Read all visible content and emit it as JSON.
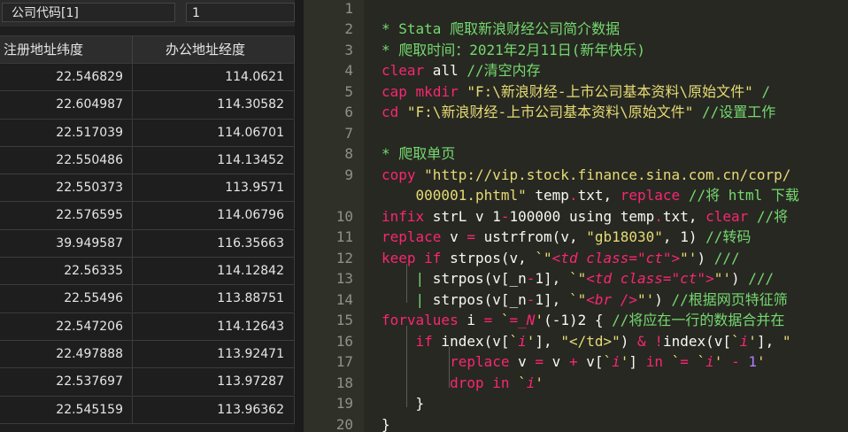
{
  "data_browser": {
    "var_name": "公司代码[1]",
    "var_value": "1",
    "columns": [
      "注册地址纬度",
      "办公地址经度"
    ],
    "rows": [
      [
        "22.546829",
        "114.0621"
      ],
      [
        "22.604987",
        "114.30582"
      ],
      [
        "22.517039",
        "114.06701"
      ],
      [
        "22.550486",
        "114.13452"
      ],
      [
        "22.550373",
        "113.9571"
      ],
      [
        "22.576595",
        "114.06796"
      ],
      [
        "39.949587",
        "116.35663"
      ],
      [
        "22.56335",
        "114.12842"
      ],
      [
        "22.55496",
        "113.88751"
      ],
      [
        "22.547206",
        "114.12643"
      ],
      [
        "22.497888",
        "113.92471"
      ],
      [
        "22.537697",
        "113.97287"
      ],
      [
        "22.545159",
        "113.96362"
      ]
    ]
  },
  "editor": {
    "lines": [
      {
        "n": "1",
        "segs": []
      },
      {
        "n": "2",
        "segs": [
          [
            "cm",
            "* Stata 爬取新浪财经公司简介数据"
          ]
        ]
      },
      {
        "n": "3",
        "segs": [
          [
            "cm",
            "* 爬取时间：2021年2月11日(新年快乐)"
          ]
        ]
      },
      {
        "n": "4",
        "segs": [
          [
            "kw",
            "clear"
          ],
          [
            "",
            " all "
          ],
          [
            "cm",
            "//清空内存"
          ]
        ]
      },
      {
        "n": "5",
        "segs": [
          [
            "kw",
            "cap"
          ],
          [
            "",
            " "
          ],
          [
            "kw",
            "mkdir"
          ],
          [
            "",
            " "
          ],
          [
            "st",
            "\"F:\\新浪财经-上市公司基本资料\\原始文件\""
          ],
          [
            "",
            " "
          ],
          [
            "cm",
            "/"
          ]
        ]
      },
      {
        "n": "6",
        "segs": [
          [
            "kw",
            "cd"
          ],
          [
            "",
            " "
          ],
          [
            "st",
            "\"F:\\新浪财经-上市公司基本资料\\原始文件\""
          ],
          [
            "",
            " "
          ],
          [
            "cm",
            "//设置工作"
          ]
        ]
      },
      {
        "n": "7",
        "segs": []
      },
      {
        "n": "8",
        "segs": [
          [
            "cm",
            "* 爬取单页"
          ]
        ]
      },
      {
        "n": "9",
        "segs": [
          [
            "kw",
            "copy"
          ],
          [
            "",
            " "
          ],
          [
            "st",
            "\"http://vip.stock.finance.sina.com.cn/corp/"
          ]
        ]
      },
      {
        "n": "",
        "segs": [
          [
            "st",
            "    000001.phtml\""
          ],
          [
            "",
            " temp"
          ],
          [
            "kw",
            "."
          ],
          [
            "",
            "txt, "
          ],
          [
            "kw",
            "replace"
          ],
          [
            "",
            " "
          ],
          [
            "cm",
            "//将 html 下载"
          ]
        ]
      },
      {
        "n": "10",
        "segs": [
          [
            "kw",
            "infix"
          ],
          [
            "",
            " strL v 1"
          ],
          [
            "kw",
            "-"
          ],
          [
            "",
            "100000 using temp"
          ],
          [
            "kw",
            "."
          ],
          [
            "",
            "txt, "
          ],
          [
            "kw",
            "clear"
          ],
          [
            "",
            " "
          ],
          [
            "cm",
            "//将"
          ]
        ]
      },
      {
        "n": "11",
        "segs": [
          [
            "kw",
            "replace"
          ],
          [
            "",
            " v "
          ],
          [
            "kw",
            "="
          ],
          [
            "",
            " ustrfrom(v, "
          ],
          [
            "st",
            "\"gb18030\""
          ],
          [
            "",
            ", 1) "
          ],
          [
            "cm",
            "//转码"
          ]
        ]
      },
      {
        "n": "12",
        "segs": [
          [
            "kw",
            "keep"
          ],
          [
            "",
            " "
          ],
          [
            "kw",
            "if"
          ],
          [
            "",
            " strpos(v, "
          ],
          [
            "st",
            "`\""
          ],
          [
            "it",
            "<td class=\"ct\">"
          ],
          [
            "st",
            "\"'"
          ],
          [
            "",
            ") "
          ],
          [
            "cm",
            "///"
          ]
        ]
      },
      {
        "n": "13",
        "segs": [
          [
            "",
            "    "
          ],
          [
            "cm",
            "|"
          ],
          [
            "",
            " strpos(v[_n"
          ],
          [
            "kw",
            "-"
          ],
          [
            "",
            "1], "
          ],
          [
            "st",
            "`\""
          ],
          [
            "it",
            "<td class=\"ct\">"
          ],
          [
            "st",
            "\"'"
          ],
          [
            "",
            ") "
          ],
          [
            "cm",
            "///"
          ]
        ]
      },
      {
        "n": "14",
        "segs": [
          [
            "",
            "    "
          ],
          [
            "cm",
            "|"
          ],
          [
            "",
            " strpos(v[_n"
          ],
          [
            "kw",
            "-"
          ],
          [
            "",
            "1], "
          ],
          [
            "st",
            "`\""
          ],
          [
            "it",
            "<br />"
          ],
          [
            "st",
            "\"'"
          ],
          [
            "",
            ") "
          ],
          [
            "cm",
            "//根据网页特征筛"
          ]
        ]
      },
      {
        "n": "15",
        "segs": [
          [
            "kw",
            "forvalues"
          ],
          [
            "",
            " i "
          ],
          [
            "kw",
            "="
          ],
          [
            "",
            " "
          ],
          [
            "st",
            "`"
          ],
          [
            "kw",
            "="
          ],
          [
            "it",
            "_N"
          ],
          [
            "st",
            "'"
          ],
          [
            "",
            "(-1)2 { "
          ],
          [
            "cm",
            "//将应在一行的数据合并在"
          ]
        ]
      },
      {
        "n": "16",
        "segs": [
          [
            "",
            "    "
          ],
          [
            "kw",
            "if"
          ],
          [
            "",
            " index(v["
          ],
          [
            "st",
            "`"
          ],
          [
            "it",
            "i"
          ],
          [
            "st",
            "'"
          ],
          [
            "",
            "], "
          ],
          [
            "st",
            "\"</td>\""
          ],
          [
            "",
            ") "
          ],
          [
            "kw",
            "&"
          ],
          [
            "",
            " "
          ],
          [
            "kw",
            "!"
          ],
          [
            "",
            "index(v["
          ],
          [
            "st",
            "`"
          ],
          [
            "it",
            "i"
          ],
          [
            "st",
            "'"
          ],
          [
            "",
            "], "
          ],
          [
            "st",
            "\""
          ]
        ]
      },
      {
        "n": "17",
        "segs": [
          [
            "",
            "        "
          ],
          [
            "kw",
            "replace"
          ],
          [
            "",
            " v "
          ],
          [
            "kw",
            "="
          ],
          [
            "",
            " v "
          ],
          [
            "kw",
            "+"
          ],
          [
            "",
            " v["
          ],
          [
            "st",
            "`"
          ],
          [
            "it",
            "i"
          ],
          [
            "st",
            "'"
          ],
          [
            "",
            "] "
          ],
          [
            "kw",
            "in"
          ],
          [
            "",
            " "
          ],
          [
            "st",
            "`"
          ],
          [
            "kw",
            "="
          ],
          [
            "",
            " "
          ],
          [
            "st",
            "`"
          ],
          [
            "it",
            "i"
          ],
          [
            "st",
            "'"
          ],
          [
            "",
            " "
          ],
          [
            "kw",
            "-"
          ],
          [
            "",
            " "
          ],
          [
            "ac",
            "1"
          ],
          [
            "st",
            "'"
          ]
        ]
      },
      {
        "n": "18",
        "segs": [
          [
            "",
            "        "
          ],
          [
            "kw",
            "drop"
          ],
          [
            "",
            " "
          ],
          [
            "kw",
            "in"
          ],
          [
            "",
            " "
          ],
          [
            "st",
            "`"
          ],
          [
            "it",
            "i"
          ],
          [
            "st",
            "'"
          ]
        ]
      },
      {
        "n": "19",
        "segs": [
          [
            "",
            "    }"
          ]
        ]
      },
      {
        "n": "20",
        "segs": [
          [
            "",
            "}"
          ]
        ]
      }
    ]
  }
}
